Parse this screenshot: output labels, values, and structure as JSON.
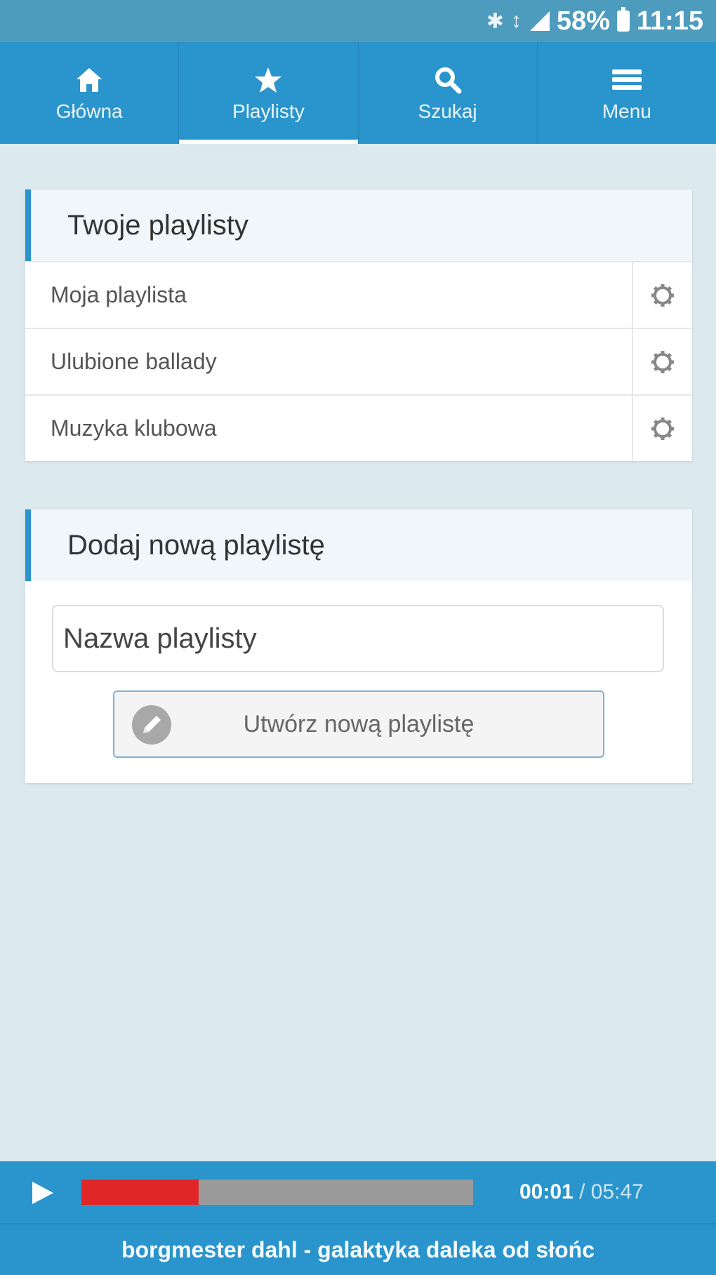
{
  "status_bar": {
    "battery_percent": "58%",
    "time": "11:15"
  },
  "nav": {
    "tabs": [
      {
        "label": "Główna",
        "icon": "home-icon",
        "active": false
      },
      {
        "label": "Playlisty",
        "icon": "star-icon",
        "active": true
      },
      {
        "label": "Szukaj",
        "icon": "search-icon",
        "active": false
      },
      {
        "label": "Menu",
        "icon": "menu-icon",
        "active": false
      }
    ]
  },
  "playlists_card": {
    "title": "Twoje playlisty",
    "items": [
      {
        "name": "Moja playlista"
      },
      {
        "name": "Ulubione ballady"
      },
      {
        "name": "Muzyka klubowa"
      }
    ]
  },
  "add_card": {
    "title": "Dodaj nową playlistę",
    "input_placeholder": "Nazwa playlisty",
    "input_value": "",
    "create_button_label": "Utwórz nową playlistę"
  },
  "player": {
    "progress_fraction": 0.3,
    "elapsed": "00:01",
    "separator": " / ",
    "total": "05:47",
    "track_title": "borgmester dahl - galaktyka daleka od słońc"
  },
  "colors": {
    "primary": "#2a94cc",
    "status_bar": "#4d9bbd",
    "background": "#dce9ef",
    "progress_fill": "#e02727",
    "progress_track": "#9a9a9a"
  }
}
